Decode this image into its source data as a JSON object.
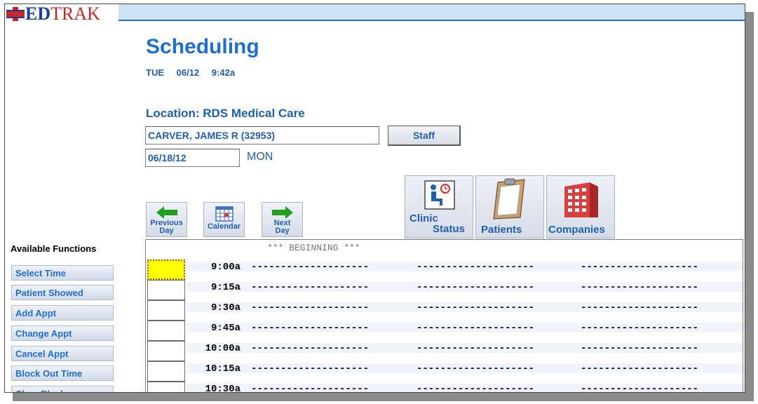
{
  "app": {
    "logo_prefix": "ED",
    "logo_suffix": "TRAK"
  },
  "header": {
    "title": "Scheduling",
    "day": "TUE",
    "date": "06/12",
    "time": "9:42a"
  },
  "location_label": "Location: RDS Medical Care",
  "patient_field": {
    "value": "CARVER, JAMES R (32953)"
  },
  "staff_button": {
    "label": "Staff"
  },
  "date_field": {
    "value": "06/18/12",
    "day_of_week": "MON"
  },
  "nav": {
    "previous_day": {
      "line1": "Previous",
      "line2": "Day"
    },
    "calendar": {
      "label": "Calendar"
    },
    "next_day": {
      "line1": "Next",
      "line2": "Day"
    }
  },
  "big_buttons": {
    "clinic_status": {
      "line1": "Clinic",
      "line2": "Status"
    },
    "patients": {
      "label": "Patients"
    },
    "companies": {
      "label": "Companies"
    }
  },
  "sidebar": {
    "heading": "Available Functions",
    "items": [
      {
        "label": "Select Time"
      },
      {
        "label": "Patient Showed"
      },
      {
        "label": "Add Appt"
      },
      {
        "label": "Change Appt"
      },
      {
        "label": "Cancel Appt"
      },
      {
        "label": "Block Out Time"
      },
      {
        "label": "Clear Block"
      }
    ]
  },
  "schedule": {
    "beginning_marker": "*** BEGINNING ***",
    "dashes": "--------------------",
    "slots": [
      {
        "time": "9:00a",
        "selected": true
      },
      {
        "time": "9:15a",
        "selected": false
      },
      {
        "time": "9:30a",
        "selected": false
      },
      {
        "time": "9:45a",
        "selected": false
      },
      {
        "time": "10:00a",
        "selected": false
      },
      {
        "time": "10:15a",
        "selected": false
      },
      {
        "time": "10:30a",
        "selected": false
      }
    ]
  },
  "colors": {
    "accent": "#1f6fd0",
    "title_band": "#cde0f5",
    "selection": "#ffff00",
    "logo_red": "#c62828",
    "logo_blue": "#1a3f9a"
  }
}
